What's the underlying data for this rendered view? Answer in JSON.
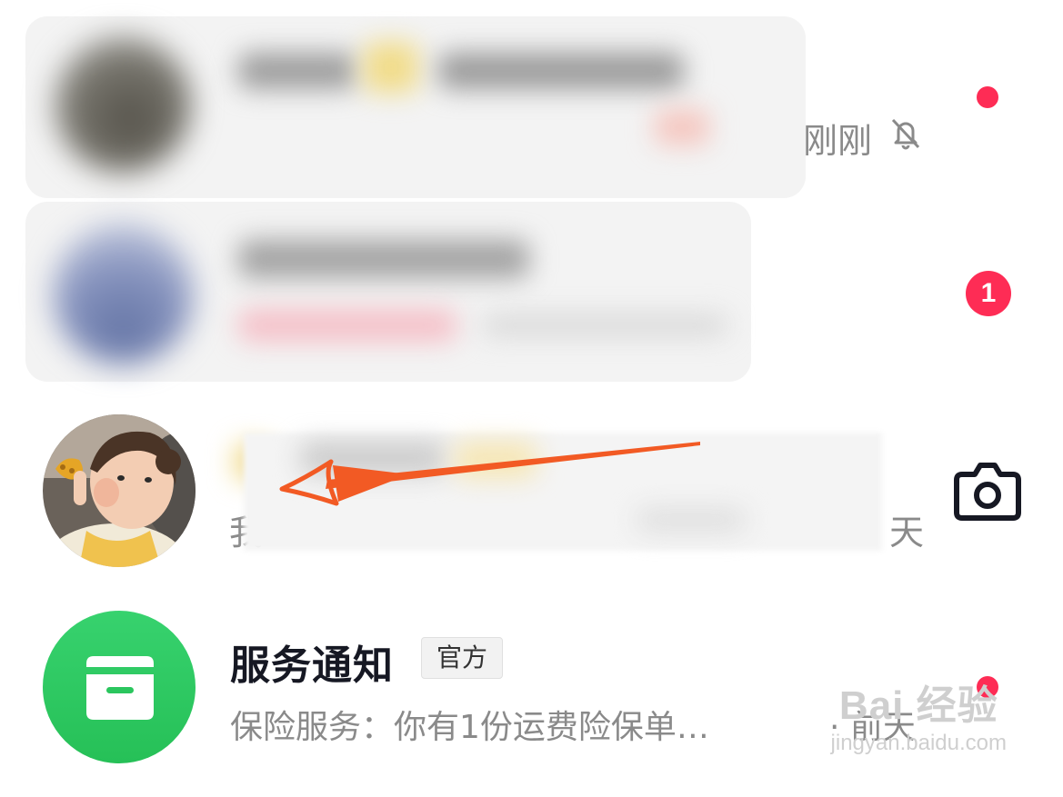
{
  "conversations": [
    {
      "name": "",
      "preview": "",
      "time": "刚刚",
      "muted_icon": "bell-off-icon",
      "unread_dot": true
    },
    {
      "name": "",
      "preview": "",
      "unread_count": "1"
    },
    {
      "name": "",
      "preview_start": "我",
      "time_end": "天",
      "action_icon": "camera-icon"
    },
    {
      "name": "服务通知",
      "tag": "官方",
      "preview": "保险服务：你有1份运费险保单…",
      "time": "· 前天",
      "unread_dot": true
    }
  ],
  "watermark": {
    "brand": "Bai 经验",
    "url": "jingyan.baidu.com"
  },
  "colors": {
    "unread_red": "#fe2c55",
    "annotation_arrow": "#f25a24",
    "service_green": "#2bc65e",
    "secondary_text": "#8a8a8a"
  }
}
